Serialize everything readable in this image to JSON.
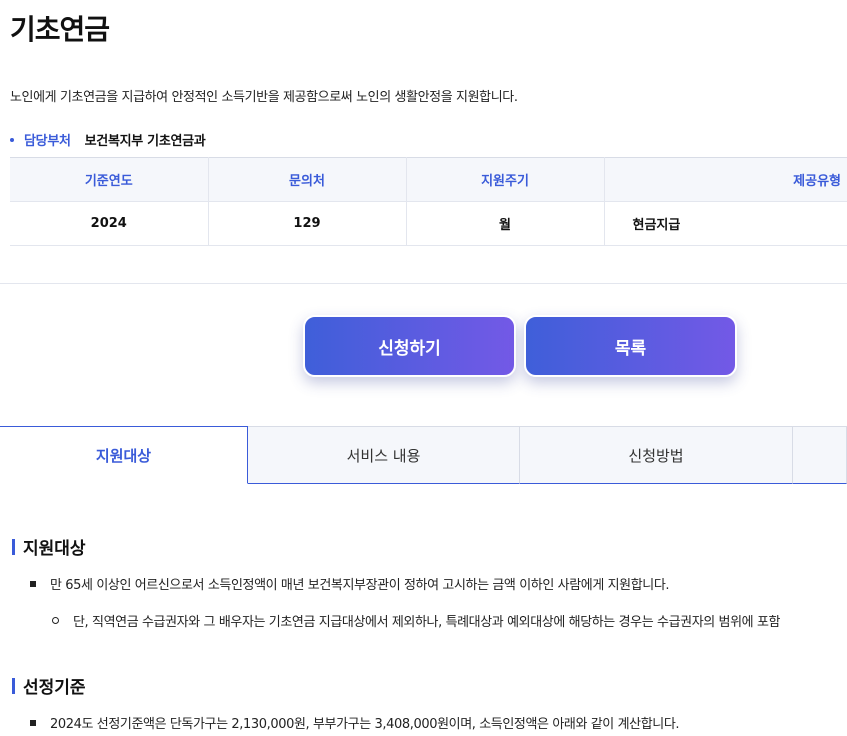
{
  "page": {
    "title": "기초연금",
    "description": "노인에게 기초연금을 지급하여 안정적인 소득기반을 제공함으로써 노인의 생활안정을 지원합니다."
  },
  "department": {
    "label": "담당부처",
    "value": "보건복지부 기초연금과"
  },
  "info_table": {
    "headers": [
      "기준연도",
      "문의처",
      "지원주기",
      "제공유형"
    ],
    "row": [
      "2024",
      "129",
      "월",
      "현금지급"
    ]
  },
  "buttons": {
    "apply": "신청하기",
    "list": "목록"
  },
  "tabs": [
    "지원대상",
    "서비스 내용",
    "신청방법",
    ""
  ],
  "sections": [
    {
      "title": "지원대상",
      "items": [
        "만 65세 이상인 어르신으로서 소득인정액이 매년 보건복지부장관이 정하여 고시하는 금액 이하인 사람에게 지원합니다.",
        "단, 직역연금 수급권자와 그 배우자는 기초연금 지급대상에서 제외하나, 특례대상과 예외대상에 해당하는 경우는 수급권자의 범위에 포함"
      ]
    },
    {
      "title": "선정기준",
      "items": [
        "2024도 선정기준액은 단독가구는 2,130,000원, 부부가구는 3,408,000원이며, 소득인정액은 아래와 같이 계산합니다."
      ]
    }
  ],
  "colors": {
    "accent": "#3a5bd9",
    "gradient_start": "#3f5fd9",
    "gradient_end": "#7359e6",
    "table_header_bg": "#f5f7fb"
  }
}
